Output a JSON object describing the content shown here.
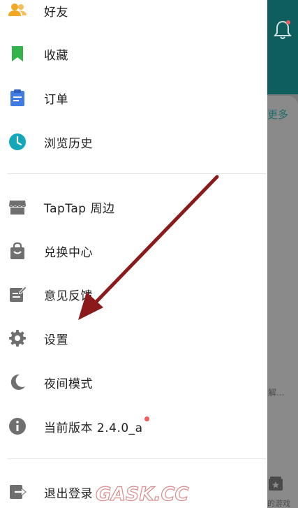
{
  "background": {
    "more_link": "更多",
    "truncated_text": "解...",
    "games_text": "的游戏"
  },
  "drawer": {
    "items": [
      {
        "label": "好友",
        "icon": "friends-icon"
      },
      {
        "label": "收藏",
        "icon": "bookmark-icon"
      },
      {
        "label": "订单",
        "icon": "order-icon"
      },
      {
        "label": "浏览历史",
        "icon": "clock-icon"
      },
      {
        "label": "TapTap 周边",
        "icon": "store-icon"
      },
      {
        "label": "兑换中心",
        "icon": "shopping-bag-icon"
      },
      {
        "label": "意见反馈",
        "icon": "feedback-edit-icon"
      },
      {
        "label": "设置",
        "icon": "gear-icon"
      },
      {
        "label": "夜间模式",
        "icon": "moon-icon"
      },
      {
        "label": "当前版本 2.4.0_a",
        "icon": "info-icon",
        "badge": "red-dot"
      },
      {
        "label": "退出登录",
        "icon": "logout-icon"
      }
    ]
  },
  "watermark": {
    "text": "GASK.CC"
  },
  "colors": {
    "friends": "#f5a623",
    "bookmark": "#34b34a",
    "order": "#3f7be3",
    "clock": "#14a7b9",
    "gray_icon": "#6f6f6f",
    "badge_red": "#f25c5c",
    "header_teal": "#0f5e5e",
    "arrow": "#8b1a1a"
  }
}
